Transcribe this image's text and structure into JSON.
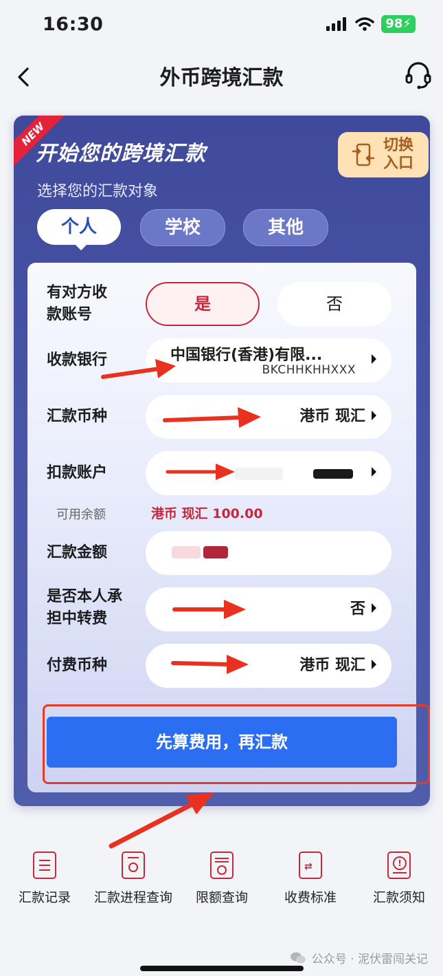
{
  "status_bar": {
    "time": "16:30",
    "battery": "98"
  },
  "header": {
    "title": "外币跨境汇款"
  },
  "card": {
    "badge": "NEW",
    "headline": "开始您的跨境汇款",
    "switch_label": "切换入口",
    "subtitle": "选择您的汇款对象",
    "tabs": [
      {
        "label": "个人"
      },
      {
        "label": "学校"
      },
      {
        "label": "其他"
      }
    ],
    "active_tab": "个人"
  },
  "form": {
    "has_account_label": "有对方收款账号",
    "yes_label": "是",
    "no_label": "否",
    "bank_label": "收款银行",
    "bank_name": "中国银行(香港)有限...",
    "bank_code": "BKCHHKHHXXX",
    "currency_label": "汇款币种",
    "currency_value": "港币 现汇",
    "debit_label": "扣款账户",
    "available_label": "可用余额",
    "available_value": "港币 现汇 100.00",
    "amount_label": "汇款金额",
    "fee_bearer_label": "是否本人承担中转费",
    "fee_bearer_value": "否",
    "fee_currency_label": "付费币种",
    "fee_currency_value": "港币 现汇",
    "submit_label": "先算费用，再汇款"
  },
  "bottom_nav": [
    {
      "label": "汇款记录",
      "icon": "list-icon"
    },
    {
      "label": "汇款进程查询",
      "icon": "search-doc-icon"
    },
    {
      "label": "限额查询",
      "icon": "limit-icon"
    },
    {
      "label": "收费标准",
      "icon": "fee-icon"
    },
    {
      "label": "汇款须知",
      "icon": "info-doc-icon"
    }
  ],
  "watermark": "公众号 · 泥伏雷闯关记",
  "colors": {
    "accent": "#2b6ef2",
    "brand_red": "#c6273a",
    "card_bg": "#3f4a9b",
    "highlight": "#e53b2a"
  }
}
